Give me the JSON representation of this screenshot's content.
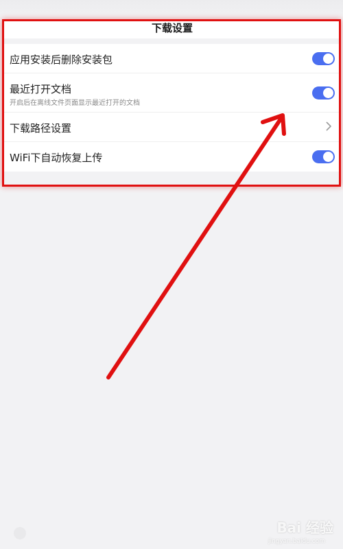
{
  "header": {
    "title": "下载设置"
  },
  "settings": {
    "items": [
      {
        "label": "应用安装后删除安装包",
        "subtitle": "",
        "control": "toggle",
        "enabled": true
      },
      {
        "label": "最近打开文档",
        "subtitle": "开启后在离线文件页面显示最近打开的文档",
        "control": "toggle",
        "enabled": true
      },
      {
        "label": "下载路径设置",
        "subtitle": "",
        "control": "chevron",
        "enabled": null
      },
      {
        "label": "WiFi下自动恢复上传",
        "subtitle": "",
        "control": "toggle",
        "enabled": true
      }
    ]
  },
  "annotation": {
    "highlight_color": "#e01010",
    "arrow_color": "#e01010"
  },
  "watermark": {
    "text": "Bai 经验",
    "url": "jingyan.baidu.com"
  },
  "colors": {
    "toggle_on": "#4a6ef0",
    "background": "#f2f2f4"
  }
}
